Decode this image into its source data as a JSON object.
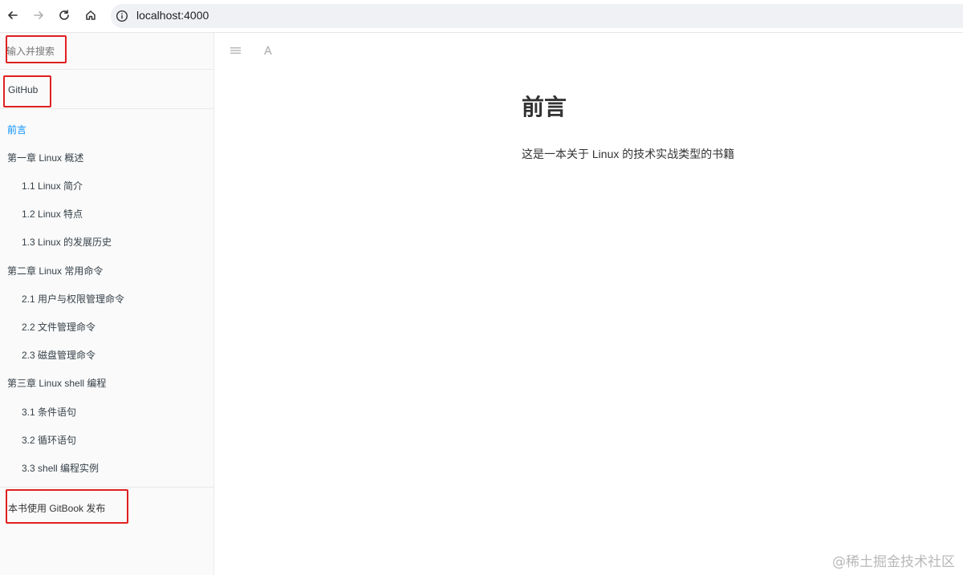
{
  "browser": {
    "url": "localhost:4000",
    "icons": [
      "back-arrow-icon",
      "forward-arrow-icon",
      "reload-icon",
      "home-icon",
      "info-icon"
    ]
  },
  "sidebar": {
    "search_placeholder": "输入并搜索",
    "github_label": "GitHub",
    "toc": [
      {
        "label": "前言",
        "active": true
      },
      {
        "label": "第一章 Linux 概述"
      },
      {
        "label": "1.1 Linux 简介"
      },
      {
        "label": "1.2 Linux 特点"
      },
      {
        "label": "1.3 Linux 的发展历史"
      },
      {
        "label": "第二章 Linux 常用命令"
      },
      {
        "label": "2.1 用户与权限管理命令"
      },
      {
        "label": "2.2 文件管理命令"
      },
      {
        "label": "2.3 磁盘管理命令"
      },
      {
        "label": "第三章 Linux shell 编程"
      },
      {
        "label": "3.1 条件语句"
      },
      {
        "label": "3.2 循环语句"
      },
      {
        "label": "3.3 shell 编程实例"
      }
    ],
    "footer_link": "本书使用 GitBook 发布"
  },
  "toolbar": {
    "icons": [
      "menu-icon",
      "font-settings-icon"
    ]
  },
  "page": {
    "title": "前言",
    "body": "这是一本关于 Linux 的技术实战类型的书籍"
  },
  "watermark": "@稀土掘金技术社区",
  "colors": {
    "active_link": "#008cff",
    "annotation": "#e02020",
    "sidebar_bg": "#fafafa"
  }
}
